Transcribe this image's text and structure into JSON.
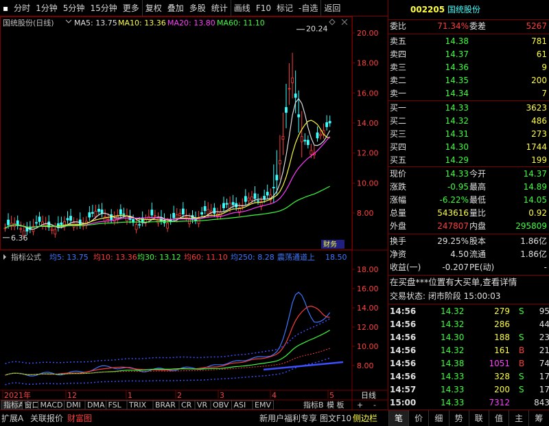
{
  "toolbar": {
    "items": [
      "分时",
      "1分钟",
      "5分钟",
      "15分钟",
      "更多",
      "复权",
      "叠加",
      "多股",
      "统计",
      "画线",
      "F10",
      "标记",
      "-自选",
      "返回"
    ]
  },
  "stock": {
    "code": "002205",
    "name": "国统股份"
  },
  "main_chart": {
    "legend_title": "国统股份(日线)",
    "ma5": "MA5: 13.75",
    "ma10": "MA10: 13.36",
    "ma20": "MA20: 13.80",
    "ma60": "MA60: 11.10",
    "high_marker": "20.24",
    "low_marker": "6.36",
    "badge": "财务",
    "y_ticks": [
      "20.00",
      "18.00",
      "16.00",
      "14.00",
      "12.00",
      "10.00",
      "8.00"
    ]
  },
  "indicator": {
    "title": "指标公式",
    "avg5": "均5: 13.75",
    "avg10": "均10: 13.36",
    "avg30": "均30: 13.12",
    "avg60": "均60: 11.10",
    "avg250": "均250: 8.28",
    "note": "震荡通道上",
    "note_val": "18.50",
    "y_ticks": [
      "18.00",
      "16.00",
      "14.00",
      "12.00",
      "10.00",
      "8.00"
    ]
  },
  "x_axis": {
    "labels": [
      "2021年",
      "12",
      "1",
      "2",
      "3",
      "4",
      "5"
    ],
    "period": "日线"
  },
  "tabs": [
    "指标A",
    "窗口",
    "MACD",
    "DMI",
    "DMA",
    "FSL",
    "TRIX",
    "BRAR",
    "CR",
    "VR",
    "OBV",
    "ASI",
    "EMV"
  ],
  "tab_right": {
    "b": "指标B",
    "model": "模 板",
    "plus": "+",
    "minus": "-"
  },
  "order_book": {
    "wb_label": "委比",
    "wb_value": "71.34%",
    "wc_label": "委差",
    "wc_value": "5267",
    "sells": [
      {
        "label": "卖五",
        "price": "14.38",
        "vol": "781"
      },
      {
        "label": "卖四",
        "price": "14.37",
        "vol": "61"
      },
      {
        "label": "卖三",
        "price": "14.36",
        "vol": "9"
      },
      {
        "label": "卖二",
        "price": "14.35",
        "vol": "200"
      },
      {
        "label": "卖一",
        "price": "14.34",
        "vol": "7"
      }
    ],
    "buys": [
      {
        "label": "买一",
        "price": "14.33",
        "vol": "3623"
      },
      {
        "label": "买二",
        "price": "14.32",
        "vol": "486"
      },
      {
        "label": "买三",
        "price": "14.31",
        "vol": "273"
      },
      {
        "label": "买四",
        "price": "14.30",
        "vol": "1744"
      },
      {
        "label": "买五",
        "price": "14.29",
        "vol": "199"
      }
    ]
  },
  "quote": [
    {
      "l1": "现价",
      "v1": "14.33",
      "c1": "green",
      "l2": "今开",
      "v2": "14.37",
      "c2": "green"
    },
    {
      "l1": "涨跌",
      "v1": "-0.95",
      "c1": "green",
      "l2": "最高",
      "v2": "14.89",
      "c2": "green"
    },
    {
      "l1": "涨幅",
      "v1": "-6.22%",
      "c1": "green",
      "l2": "最低",
      "v2": "14.05",
      "c2": "green"
    },
    {
      "l1": "总量",
      "v1": "543616",
      "c1": "yellow",
      "l2": "量比",
      "v2": "0.92",
      "c2": "yellow"
    },
    {
      "l1": "外盘",
      "v1": "247807",
      "c1": "red",
      "l2": "内盘",
      "v2": "295809",
      "c2": "green"
    }
  ],
  "fundamentals": [
    {
      "l1": "换手",
      "v1": "29.25%",
      "l2": "股本",
      "v2": "1.86亿"
    },
    {
      "l1": "净资",
      "v1": "4.50",
      "l2": "流通",
      "v2": "1.86亿"
    },
    {
      "l1": "收益(一)",
      "v1": "-0.207",
      "l2": "PE(动)",
      "v2": "-"
    }
  ],
  "notice": "在买盘***位置有大买单,查看详情",
  "trade_state": "交易状态: 闭市阶段 15:00:03",
  "ticks": [
    {
      "t": "14:56",
      "p": "14.32",
      "v": "279",
      "s": "S",
      "n": "95",
      "vc": "yellow",
      "sc": "green"
    },
    {
      "t": "14:56",
      "p": "14.32",
      "v": "286",
      "s": "",
      "n": "44",
      "vc": "yellow",
      "sc": "green"
    },
    {
      "t": "14:56",
      "p": "14.30",
      "v": "188",
      "s": "S",
      "n": "23",
      "vc": "yellow",
      "sc": "green"
    },
    {
      "t": "14:56",
      "p": "14.32",
      "v": "161",
      "s": "B",
      "n": "21",
      "vc": "yellow",
      "sc": "red"
    },
    {
      "t": "14:56",
      "p": "14.38",
      "v": "1051",
      "s": "B",
      "n": "74",
      "vc": "mag",
      "sc": "red"
    },
    {
      "t": "14:56",
      "p": "14.33",
      "v": "328",
      "s": "S",
      "n": "17",
      "vc": "yellow",
      "sc": "green"
    },
    {
      "t": "14:57",
      "p": "14.33",
      "v": "200",
      "s": "S",
      "n": "17",
      "vc": "yellow",
      "sc": "green"
    },
    {
      "t": "15:00",
      "p": "14.33",
      "v": "7312",
      "s": "",
      "n": "843",
      "vc": "mag",
      "sc": "green"
    }
  ],
  "bottom": {
    "left": [
      "扩展A",
      "关联报价",
      "财富图"
    ],
    "mid": [
      "新用户福利专享",
      "图文F10",
      "侧边栏"
    ],
    "right": [
      "笔",
      "价",
      "细",
      "势",
      "联",
      "值",
      "主",
      "筹"
    ]
  }
}
